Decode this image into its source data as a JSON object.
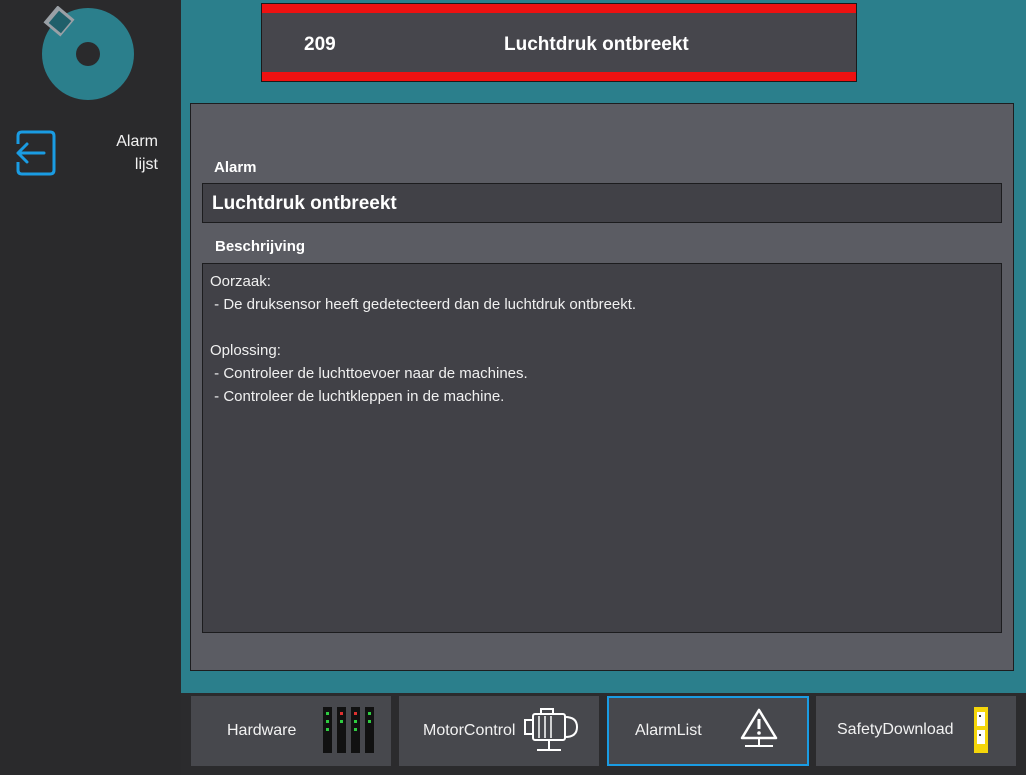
{
  "sidebar": {
    "back_label_line1": "Alarm",
    "back_label_line2": "lijst"
  },
  "alarm": {
    "number": "209",
    "title": "Luchtdruk ontbreekt"
  },
  "panel": {
    "alarm_label": "Alarm",
    "alarm_value": "Luchtdruk ontbreekt",
    "description_label": "Beschrijving",
    "description_lines": [
      "Oorzaak:",
      " - De druksensor heeft gedetecteerd dan de luchtdruk ontbreekt.",
      "",
      "Oplossing:",
      " - Controleer de luchttoevoer naar de machines.",
      " - Controleer de luchtkleppen in de machine."
    ]
  },
  "nav": [
    {
      "label": "Hardware",
      "icon": "hardware-io-icon",
      "active": false
    },
    {
      "label": "MotorControl",
      "icon": "motor-icon",
      "active": false
    },
    {
      "label": "AlarmList",
      "icon": "warning-triangle-icon",
      "active": true
    },
    {
      "label": "SafetyDownload",
      "icon": "safety-module-icon",
      "active": false
    }
  ],
  "colors": {
    "main_bg": "#2b7f8c",
    "alarm_stripe": "#ee1111",
    "active_border": "#1a9ce3",
    "safety_yellow": "#f5d60a"
  }
}
